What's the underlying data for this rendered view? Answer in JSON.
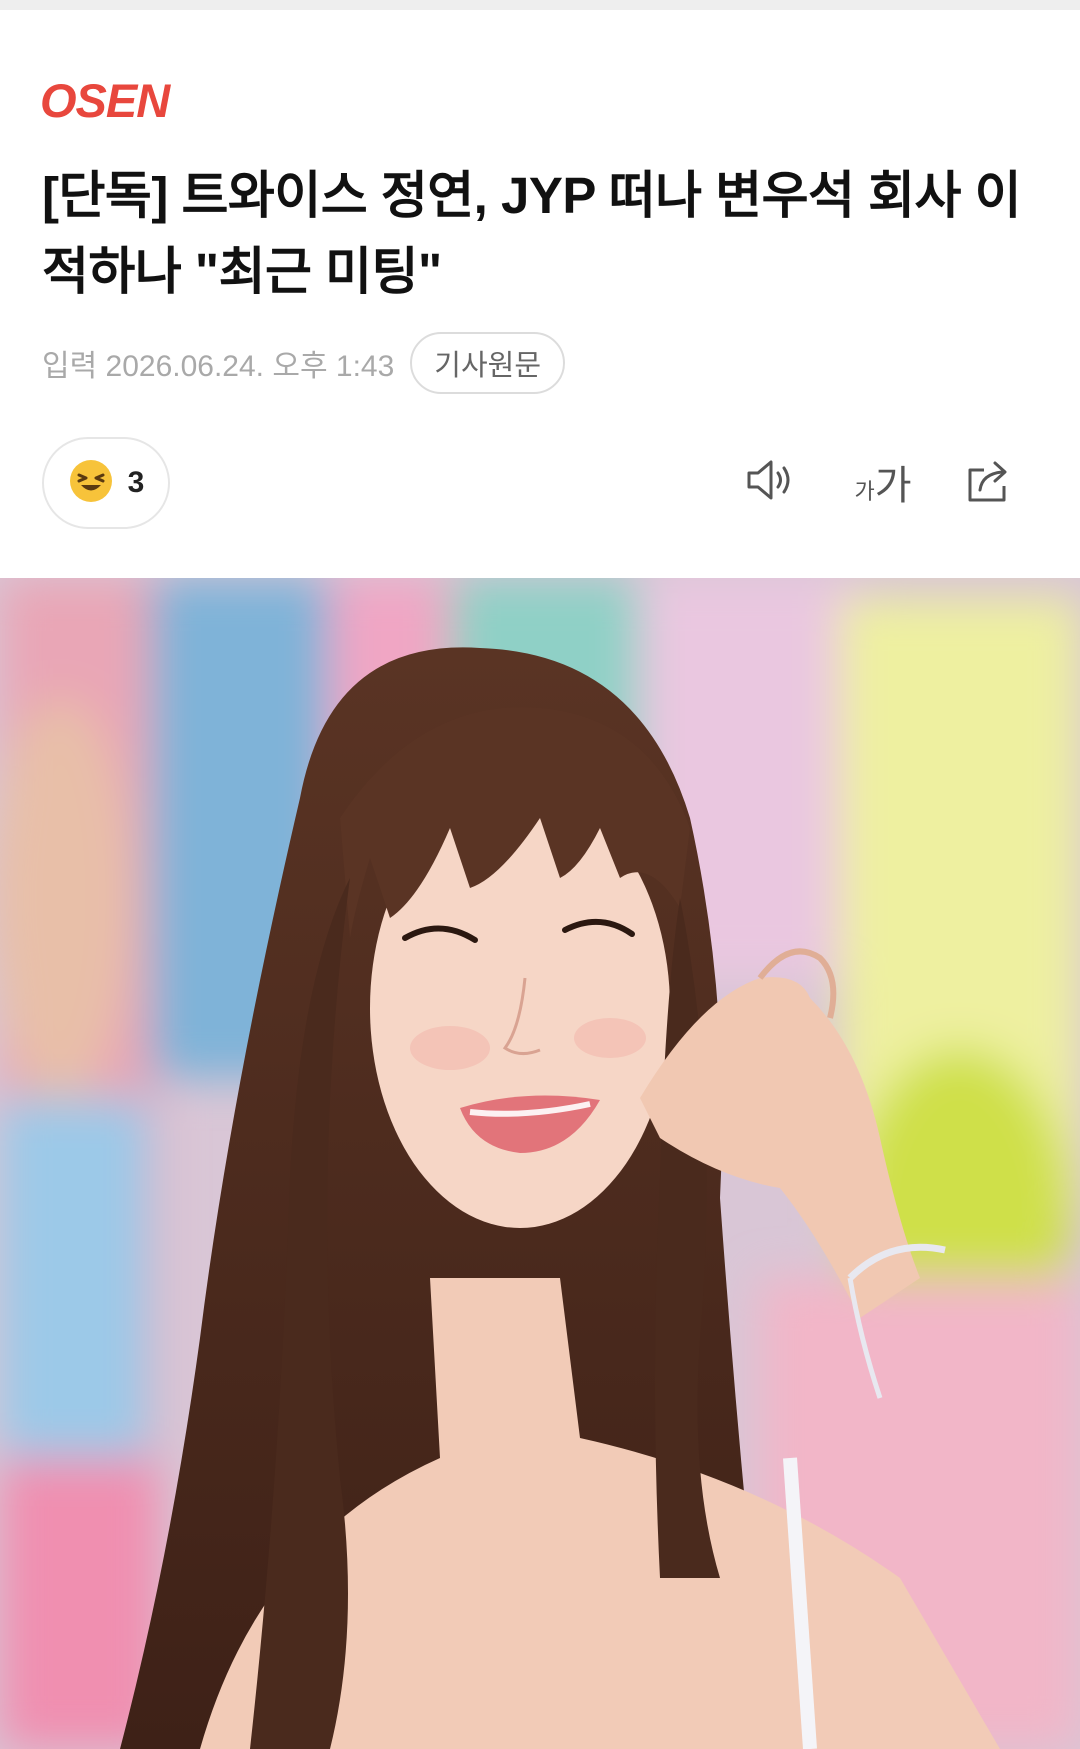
{
  "brand": {
    "logo_text": "OSEN",
    "color": "#e8473d"
  },
  "article": {
    "title": "[단독] 트와이스 정연, JYP 떠나 변우석 회사 이적하나 \"최근 미팅\"",
    "date": "입력 2026.06.24. 오후 1:43",
    "source_button": "기사원문"
  },
  "toolbar": {
    "reaction_icon": "laughing-face-icon",
    "reaction_count": "3",
    "tts_icon": "speaker-icon",
    "font_icon": "font-size-icon",
    "font_small": "가",
    "font_big": "가",
    "share_icon": "share-icon"
  },
  "image": {
    "description_icon": "article-photo"
  }
}
